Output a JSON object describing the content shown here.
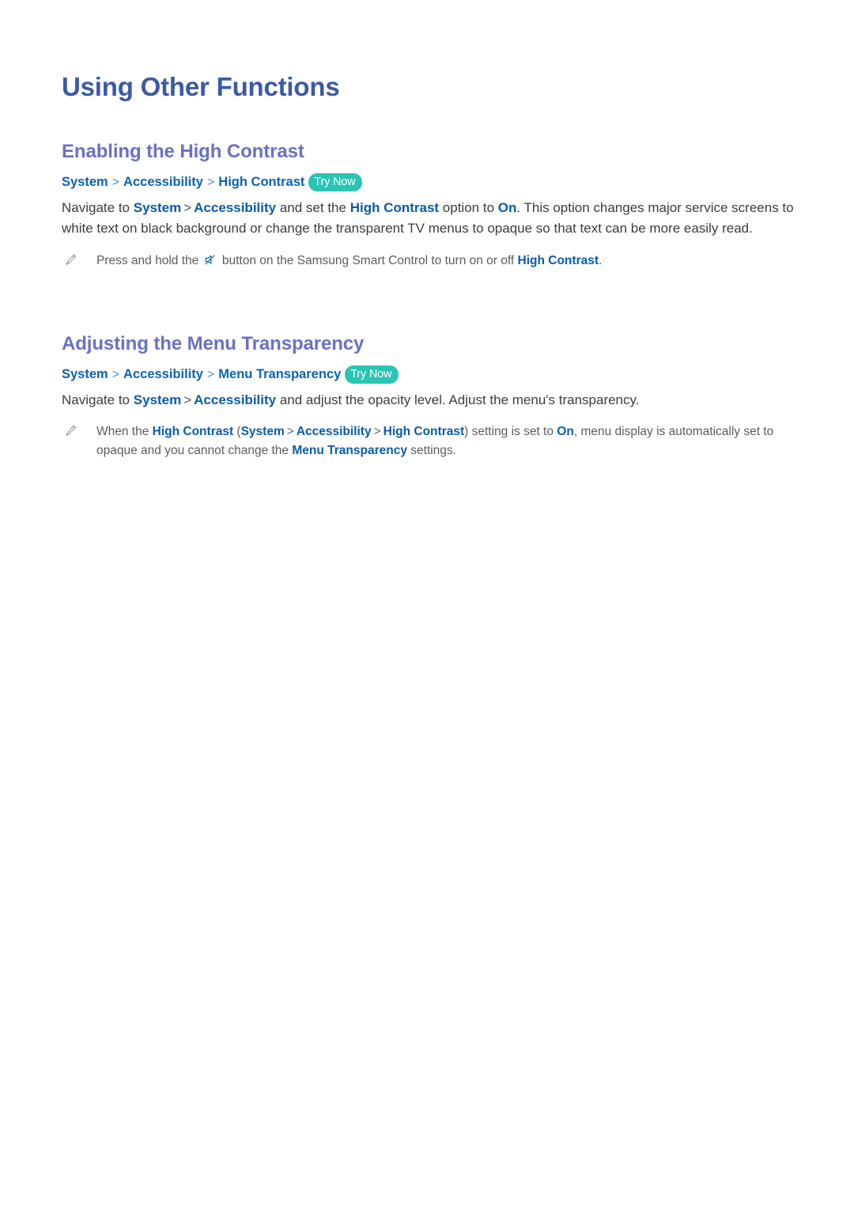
{
  "page": {
    "title": "Using Other Functions"
  },
  "sections": [
    {
      "heading": "Enabling the High Contrast",
      "path": {
        "crumb1": "System",
        "sep1": ">",
        "crumb2": "Accessibility",
        "sep2": ">",
        "crumb3": "High Contrast",
        "badge": "Try Now"
      },
      "body": {
        "t1": "Navigate to ",
        "link1": "System",
        "sep1": ">",
        "link2": "Accessibility",
        "t2": " and set the ",
        "link3": "High Contrast",
        "t3": " option to ",
        "link4": "On",
        "t4": ". This option changes major service screens to white text on black background or change the transparent TV menus to opaque so that text can be more easily read."
      },
      "note": {
        "icon": "pencil-icon",
        "t1": "Press and hold the ",
        "inline_icon": "mute-icon",
        "t2": " button on the Samsung Smart Control to turn on or off ",
        "link1": "High Contrast",
        "t3": "."
      }
    },
    {
      "heading": "Adjusting the Menu Transparency",
      "path": {
        "crumb1": "System",
        "sep1": ">",
        "crumb2": "Accessibility",
        "sep2": ">",
        "crumb3": "Menu Transparency",
        "badge": "Try Now"
      },
      "body": {
        "t1": "Navigate to ",
        "link1": "System",
        "sep1": ">",
        "link2": "Accessibility",
        "t2": " and adjust the opacity level. Adjust the menu's transparency."
      },
      "note": {
        "icon": "pencil-icon",
        "t1": "When the ",
        "link1": "High Contrast",
        "paren_open": " (",
        "link2": "System",
        "sep1": ">",
        "link3": "Accessibility",
        "sep2": ">",
        "link4": "High Contrast",
        "paren_close": ")",
        "t2": " setting is set to ",
        "link5": "On",
        "t3": ", menu display is automatically set to opaque and you cannot change the ",
        "link6": "Menu Transparency",
        "t4": " settings."
      }
    }
  ],
  "colors": {
    "page_title": "#3b5aa3",
    "section_heading": "#6a71c4",
    "breadcrumb": "#0b63b0",
    "inline_link": "#0a5ba8",
    "badge_bg": "#2bc4b4",
    "badge_text": "#ffffff",
    "body_text": "#3c3c3c",
    "note_text": "#5d5d5d",
    "pencil_icon": "#9a9a9a",
    "mute_icon": "#1572b8",
    "background": "#ffffff"
  }
}
